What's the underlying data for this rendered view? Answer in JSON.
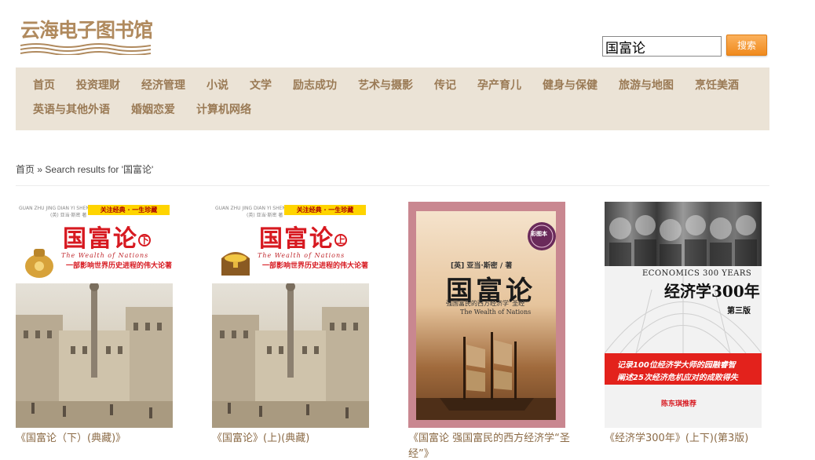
{
  "site": {
    "logo_text": "云海电子图书馆"
  },
  "search": {
    "value": "国富论",
    "button_label": "搜索"
  },
  "nav": {
    "items": [
      "首页",
      "投资理财",
      "经济管理",
      "小说",
      "文学",
      "励志成功",
      "艺术与摄影",
      "传记",
      "孕产育儿",
      "健身与保健",
      "旅游与地图",
      "烹饪美酒",
      "英语与其他外语",
      "婚姻恋爱",
      "计算机网络"
    ]
  },
  "breadcrumb": {
    "home": "首页",
    "separator": "»",
    "current": "Search results for '国富论'"
  },
  "books": [
    {
      "title": "《国富论（下）(典藏)》",
      "cover": {
        "main_title": "国富论",
        "volume": "下",
        "tag": "关注经典 · 一生珍藏",
        "pinyin": "GUAN ZHU JING DIAN YI SHENG ZHEN CANG",
        "author": "(英) 亚当·斯密 著",
        "english": "The Wealth of Nations",
        "tagline": "一部影响世界历史进程的伟大论著"
      }
    },
    {
      "title": "《国富论》(上)(典藏)",
      "cover": {
        "main_title": "国富论",
        "volume": "上",
        "tag": "关注经典 · 一生珍藏",
        "pinyin": "GUAN ZHU JING DIAN YI SHENG ZHEN CANG",
        "author": "(英) 亚当·斯密 著",
        "english": "The Wealth of Nations",
        "tagline": "一部影响世界历史进程的伟大论著"
      }
    },
    {
      "title": "《国富论 强国富民的西方经济学“圣经”》",
      "cover": {
        "author": "[英] 亚当·斯密 / 著",
        "main_title": "国富论",
        "subtitle": "强国富民的西方经济学“圣经”",
        "english": "The Wealth of Nations",
        "badge": "彩图本"
      }
    },
    {
      "title": "《经济学300年》(上下)(第3版)",
      "cover": {
        "english": "ECONOMICS 300 YEARS",
        "main_title": "经济学300年",
        "edition": "第三版",
        "red_line1": "记录100位经济学大师的园融睿智",
        "red_line2": "阐述25次经济危机应对的成败得失",
        "recommend": "陈东琪推荐"
      }
    }
  ],
  "colors": {
    "nav_bg": "#ebe3d6",
    "nav_text": "#9a7a55",
    "logo": "#b08a5e",
    "button": "#f08a1d",
    "link": "#8b6a45"
  }
}
